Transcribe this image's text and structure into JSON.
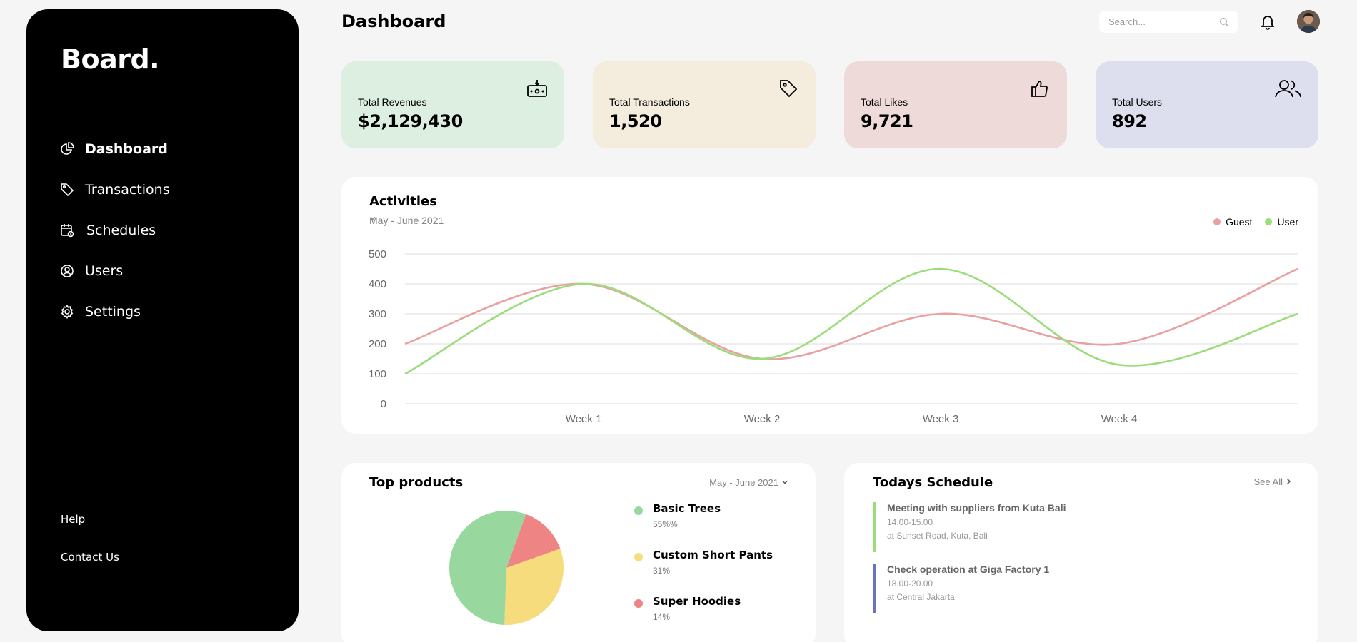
{
  "sidebar": {
    "brand": "Board.",
    "nav": [
      {
        "label": "Dashboard",
        "icon": "pie-chart-icon"
      },
      {
        "label": "Transactions",
        "icon": "tag-icon"
      },
      {
        "label": "Schedules",
        "icon": "calendar-icon"
      },
      {
        "label": "Users",
        "icon": "user-circle-icon"
      },
      {
        "label": "Settings",
        "icon": "gear-icon"
      }
    ],
    "help": "Help",
    "contact": "Contact Us"
  },
  "header": {
    "title": "Dashboard",
    "search_placeholder": "Search..."
  },
  "cards": [
    {
      "label": "Total Revenues",
      "value": "$2,129,430",
      "color": "#ddefe0",
      "icon": "money-icon"
    },
    {
      "label": "Total Transactions",
      "value": "1,520",
      "color": "#f4ecdd",
      "icon": "tag-icon"
    },
    {
      "label": "Total Likes",
      "value": "9,721",
      "color": "#efdada",
      "icon": "thumbs-up-icon"
    },
    {
      "label": "Total Users",
      "value": "892",
      "color": "#dedfee",
      "icon": "users-icon"
    }
  ],
  "activities": {
    "title": "Activities",
    "range": "May - June 2021",
    "legend": [
      {
        "name": "Guest",
        "color": "#e9a0a0"
      },
      {
        "name": "User",
        "color": "#9bdd7c"
      }
    ]
  },
  "chart_data": {
    "type": "line",
    "x_labels": [
      "Week 1",
      "Week 2",
      "Week 3",
      "Week 4"
    ],
    "x": [
      0,
      1,
      2,
      3,
      4,
      5
    ],
    "ylim": [
      0,
      500
    ],
    "yticks": [
      0,
      100,
      200,
      300,
      400,
      500
    ],
    "grid": true,
    "legend_position": "top-right",
    "series": [
      {
        "name": "Guest",
        "color": "#e9a0a0",
        "values": [
          200,
          400,
          150,
          300,
          200,
          450
        ]
      },
      {
        "name": "User",
        "color": "#9bdd7c",
        "values": [
          100,
          400,
          150,
          450,
          130,
          300
        ]
      }
    ]
  },
  "products": {
    "title": "Top products",
    "range": "May - June 2021",
    "items": [
      {
        "name": "Basic Trees",
        "pct_label": "55%%",
        "value": 55,
        "color": "#98d89e"
      },
      {
        "name": "Custom Short Pants",
        "pct_label": "31%",
        "value": 31,
        "color": "#f6dc7d"
      },
      {
        "name": "Super Hoodies",
        "pct_label": "14%",
        "value": 14,
        "color": "#ee8484"
      }
    ]
  },
  "schedule": {
    "title": "Todays Schedule",
    "see_all": "See All",
    "events": [
      {
        "title": "Meeting with suppliers from Kuta Bali",
        "time": "14.00-15.00",
        "place": "at Sunset Road, Kuta, Bali",
        "color": "#9bdd7c"
      },
      {
        "title": "Check operation at Giga Factory 1",
        "time": "18.00-20.00",
        "place": "at Central Jakarta",
        "color": "#6972c3"
      }
    ]
  }
}
